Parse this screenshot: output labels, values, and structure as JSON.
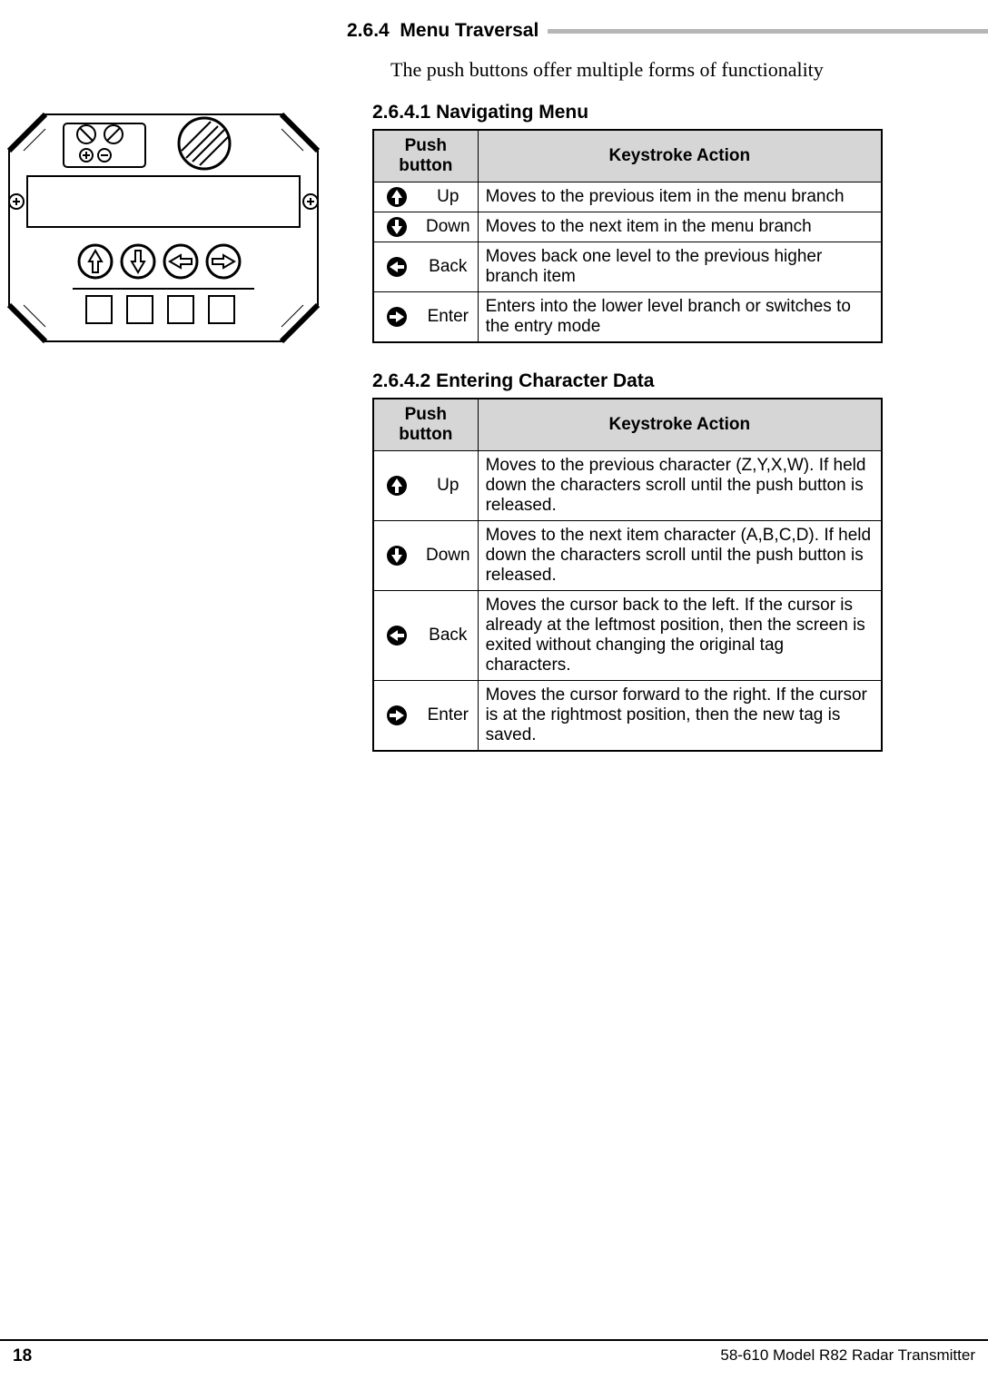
{
  "section": {
    "number": "2.6.4",
    "title": "Menu Traversal"
  },
  "intro": "The push buttons offer multiple forms of functionality",
  "sub1": {
    "number": "2.6.4.1",
    "title": "Navigating Menu"
  },
  "table1": {
    "h1": "Push button",
    "h2": "Keystroke Action",
    "rows": [
      {
        "label": "Up",
        "action": "Moves to the previous item in the menu branch"
      },
      {
        "label": "Down",
        "action": "Moves to the next item in the menu branch"
      },
      {
        "label": "Back",
        "action": "Moves back one level to the previous higher branch item"
      },
      {
        "label": "Enter",
        "action": "Enters into the lower level branch or switches to the entry mode"
      }
    ]
  },
  "sub2": {
    "number": "2.6.4.2",
    "title": "Entering Character Data"
  },
  "table2": {
    "h1": "Push button",
    "h2": "Keystroke Action",
    "rows": [
      {
        "label": "Up",
        "action": "Moves to the previous character (Z,Y,X,W). If held down the characters scroll until the push button is released."
      },
      {
        "label": "Down",
        "action": "Moves to the next item character (A,B,C,D). If held down the characters scroll until the push button is released."
      },
      {
        "label": "Back",
        "action": "Moves the cursor back to the left. If the cursor is already at the leftmost position, then the screen is exited without changing the original tag characters."
      },
      {
        "label": "Enter",
        "action": "Moves the cursor forward to the right. If the cursor is at the rightmost position, then the new tag is saved."
      }
    ]
  },
  "footer": {
    "page": "18",
    "doc": "58-610 Model R82 Radar Transmitter"
  }
}
